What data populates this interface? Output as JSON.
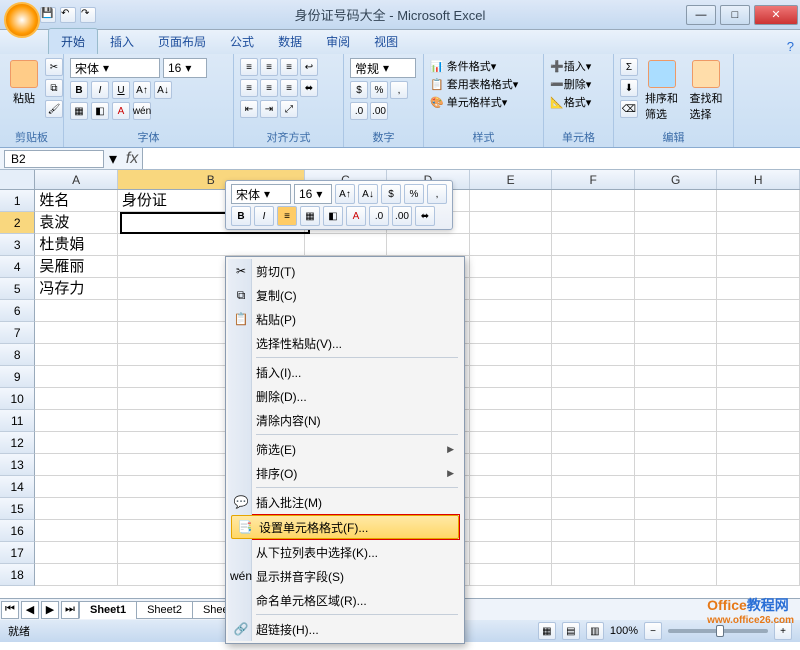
{
  "title": "身份证号码大全 - Microsoft Excel",
  "tabs": [
    "开始",
    "插入",
    "页面布局",
    "公式",
    "数据",
    "审阅",
    "视图"
  ],
  "ribbon": {
    "clipboard": {
      "label": "剪贴板",
      "paste": "粘贴"
    },
    "font": {
      "label": "字体",
      "name": "宋体",
      "size": "16",
      "b": "B",
      "i": "I",
      "u": "U"
    },
    "align": {
      "label": "对齐方式"
    },
    "number": {
      "label": "数字",
      "fmt": "常规"
    },
    "styles": {
      "label": "样式",
      "cond": "条件格式",
      "tbl": "套用表格格式",
      "cell": "单元格样式"
    },
    "cells": {
      "label": "单元格",
      "ins": "插入",
      "del": "删除",
      "fmt": "格式"
    },
    "edit": {
      "label": "编辑",
      "sort": "排序和筛选",
      "find": "查找和选择"
    }
  },
  "namebox": "B2",
  "columns": [
    "A",
    "B",
    "C",
    "D",
    "E",
    "F",
    "G",
    "H"
  ],
  "cells": {
    "A1": "姓名",
    "B1": "身份证",
    "A2": "袁波",
    "A3": "杜贵娟",
    "A4": "吴雁丽",
    "A5": "冯存力"
  },
  "mini": {
    "font": "宋体",
    "size": "16",
    "pct": "%"
  },
  "ctx": {
    "cut": "剪切(T)",
    "copy": "复制(C)",
    "paste": "粘贴(P)",
    "pastesp": "选择性粘贴(V)...",
    "insert": "插入(I)...",
    "delete": "删除(D)...",
    "clear": "清除内容(N)",
    "filter": "筛选(E)",
    "sort": "排序(O)",
    "comment": "插入批注(M)",
    "format": "设置单元格格式(F)...",
    "dropdown": "从下拉列表中选择(K)...",
    "pinyin": "显示拼音字段(S)",
    "namerange": "命名单元格区域(R)...",
    "link": "超链接(H)..."
  },
  "sheets": [
    "Sheet1",
    "Sheet2",
    "Sheet3"
  ],
  "status": {
    "ready": "就绪",
    "zoom": "100%"
  },
  "watermark": {
    "t1": "Office",
    "t2": "教程网",
    "url": "www.office26.com"
  }
}
